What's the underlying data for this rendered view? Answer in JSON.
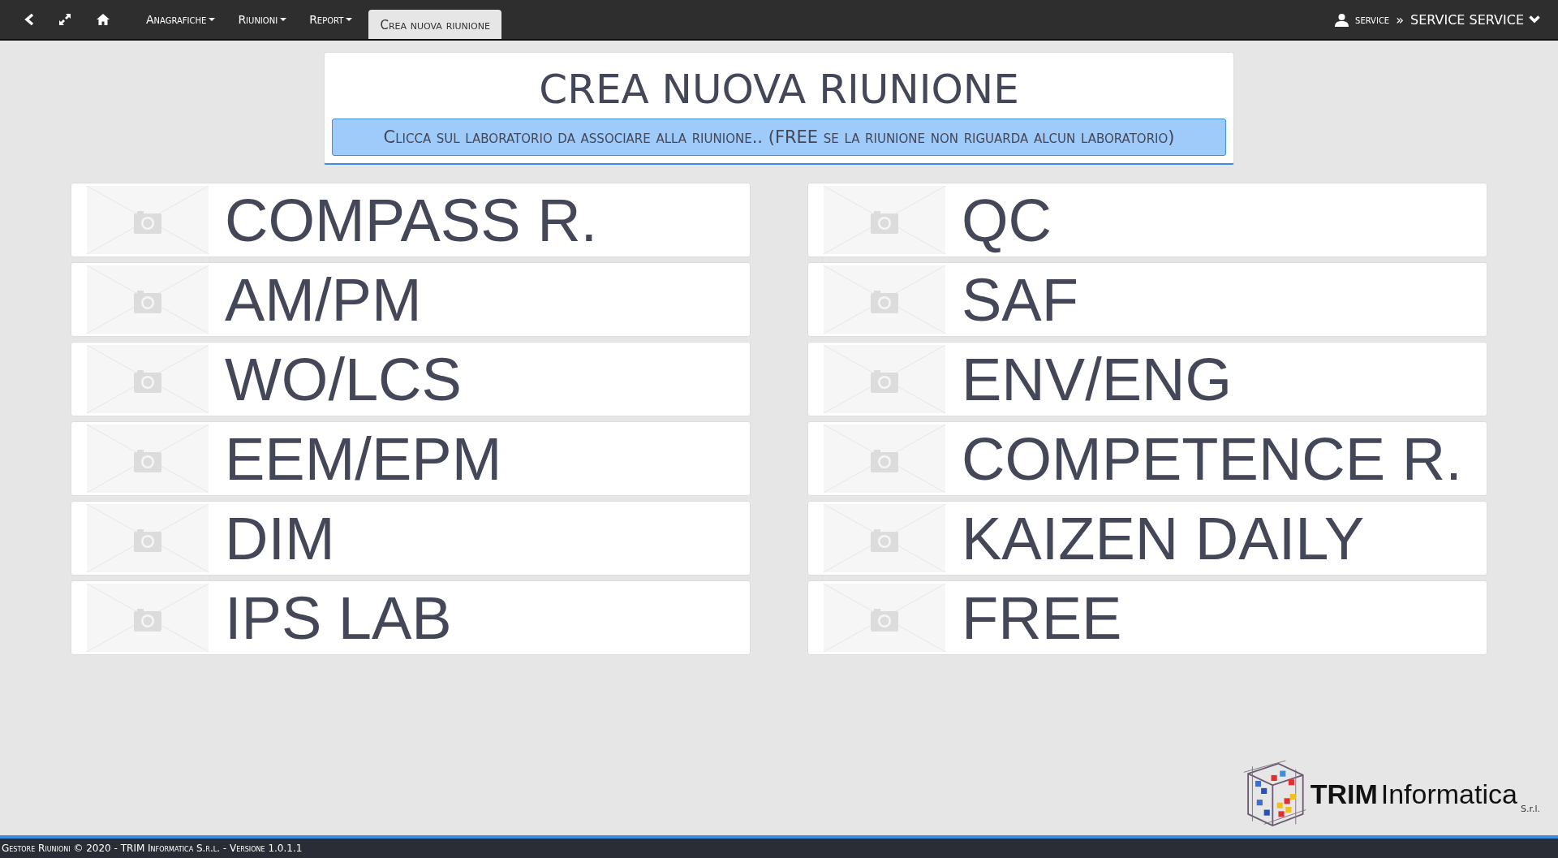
{
  "navbar": {
    "items": [
      {
        "label": "Anagrafiche",
        "kind": "dropdown",
        "selected": false
      },
      {
        "label": "Riunioni",
        "kind": "dropdown",
        "selected": false
      },
      {
        "label": "Report",
        "kind": "dropdown",
        "selected": false
      },
      {
        "label": "Crea nuova riunione",
        "kind": "tab",
        "selected": true
      }
    ],
    "user": {
      "login": "service",
      "separator": "»",
      "name": "SERVICE SERVICE"
    }
  },
  "header": {
    "title": "CREA NUOVA RIUNIONE",
    "hint": "Clicca sul laboratorio da associare alla riunione.. (FREE se la riunione non riguarda alcun laboratorio)"
  },
  "laboratories": [
    "COMPASS R.",
    "QC",
    "AM/PM",
    "SAF",
    "WO/LCS",
    "ENV/ENG",
    "EEM/EPM",
    "COMPETENCE R.",
    "DIM",
    "KAIZEN DAILY",
    "IPS LAB",
    "FREE"
  ],
  "logo": {
    "brand": "TRIM",
    "word": "Informatica",
    "suffix": "S.r.l."
  },
  "footer": "Gestore Riunioni © 2020 - TRIM Informatica S.r.l. - Versione 1.0.1.1"
}
